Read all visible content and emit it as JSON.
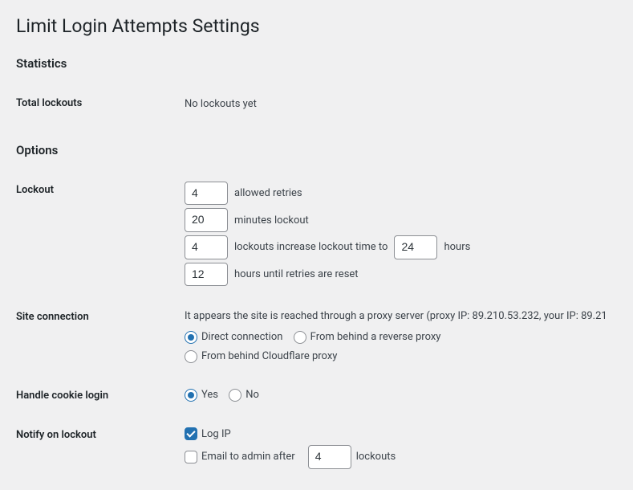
{
  "page_title": "Limit Login Attempts Settings",
  "statistics": {
    "heading": "Statistics",
    "total_lockouts_label": "Total lockouts",
    "total_lockouts_value": "No lockouts yet"
  },
  "options": {
    "heading": "Options",
    "lockout": {
      "label": "Lockout",
      "allowed_retries_value": "4",
      "allowed_retries_text": "allowed retries",
      "minutes_lockout_value": "20",
      "minutes_lockout_text": "minutes lockout",
      "lockouts_increase_value": "4",
      "lockouts_increase_text": "lockouts increase lockout time to",
      "lockouts_increase_hours_value": "24",
      "hours_text": "hours",
      "hours_until_reset_value": "12",
      "hours_until_reset_text": "hours until retries are reset"
    },
    "site_connection": {
      "label": "Site connection",
      "info_text": "It appears the site is reached through a proxy server (proxy IP: 89.210.53.232, your IP: 89.21",
      "direct_label": "Direct connection",
      "reverse_proxy_label": "From behind a reverse proxy",
      "cloudflare_label": "From behind Cloudflare proxy"
    },
    "handle_cookie": {
      "label": "Handle cookie login",
      "yes_label": "Yes",
      "no_label": "No"
    },
    "notify": {
      "label": "Notify on lockout",
      "log_ip_label": "Log IP",
      "email_admin_label": "Email to admin after",
      "email_admin_value": "4",
      "lockouts_text": "lockouts"
    }
  }
}
